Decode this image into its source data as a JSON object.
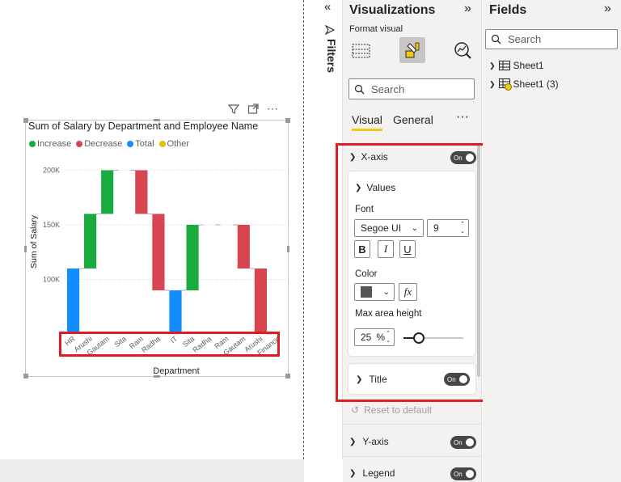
{
  "visual": {
    "title": "Sum of Salary by Department and Employee Name",
    "legend": [
      {
        "label": "Increase",
        "color": "#1aab40"
      },
      {
        "label": "Decrease",
        "color": "#d64550"
      },
      {
        "label": "Total",
        "color": "#118dff"
      },
      {
        "label": "Other",
        "color": "#e6c000"
      }
    ],
    "xlabel": "Department",
    "ylabel": "Sum of Salary",
    "header_icons": [
      "filter-icon",
      "focus-mode-icon",
      "more-options-icon"
    ]
  },
  "chart_data": {
    "type": "bar",
    "subtype": "waterfall",
    "title": "Sum of Salary by Department and Employee Name",
    "xlabel": "Department",
    "ylabel": "Sum of Salary",
    "ylim": [
      50000,
      210000
    ],
    "yticks": [
      "100K",
      "150K",
      "200K"
    ],
    "grid": true,
    "legend_position": "top-left",
    "categories": [
      "HR",
      "Arushi",
      "Gautam",
      "Sita",
      "Ram",
      "Radha",
      "IT",
      "Sita",
      "Radha",
      "Ram",
      "Gautam",
      "Arushi",
      "Finance"
    ],
    "bars": [
      {
        "label": "HR",
        "kind": "Total",
        "start": 50000,
        "end": 110000
      },
      {
        "label": "Arushi",
        "kind": "Increase",
        "start": 110000,
        "end": 160000
      },
      {
        "label": "Gautam",
        "kind": "Increase",
        "start": 160000,
        "end": 200000
      },
      {
        "label": "Sita",
        "kind": "Increase",
        "start": 200000,
        "end": 200000
      },
      {
        "label": "Ram",
        "kind": "Decrease",
        "start": 200000,
        "end": 160000
      },
      {
        "label": "Radha",
        "kind": "Decrease",
        "start": 160000,
        "end": 90000
      },
      {
        "label": "IT",
        "kind": "Total",
        "start": 50000,
        "end": 90000
      },
      {
        "label": "Sita",
        "kind": "Increase",
        "start": 90000,
        "end": 150000
      },
      {
        "label": "Radha",
        "kind": "Increase",
        "start": 150000,
        "end": 150000
      },
      {
        "label": "Ram",
        "kind": "Increase",
        "start": 150000,
        "end": 150000
      },
      {
        "label": "Gautam",
        "kind": "Decrease",
        "start": 150000,
        "end": 110000
      },
      {
        "label": "Arushi",
        "kind": "Decrease",
        "start": 110000,
        "end": 50000
      },
      {
        "label": "Finance",
        "kind": "Total",
        "start": 50000,
        "end": 50000
      }
    ]
  },
  "filters": {
    "label": "Filters"
  },
  "visualizations": {
    "title": "Visualizations",
    "subtitle": "Format visual",
    "search_placeholder": "Search",
    "tabs": [
      "Visual",
      "General"
    ],
    "more": "···",
    "xaxis": {
      "title": "X-axis",
      "toggle": "On",
      "values": {
        "title": "Values",
        "font_label": "Font",
        "font": "Segoe UI",
        "size": "9",
        "bold": "B",
        "italic": "I",
        "underline": "U",
        "color_label": "Color",
        "color": "#555555",
        "fx": "fx",
        "max_height_label": "Max area height",
        "max_height_value": "25",
        "max_height_unit": "%",
        "max_height_fraction": 0.25
      },
      "title_section": {
        "title": "Title",
        "toggle": "On"
      }
    },
    "reset": "Reset to default",
    "yaxis": {
      "title": "Y-axis",
      "toggle": "On"
    },
    "legend": {
      "title": "Legend",
      "toggle": "On"
    }
  },
  "fields": {
    "title": "Fields",
    "search_placeholder": "Search",
    "items": [
      "Sheet1",
      "Sheet1 (3)"
    ]
  }
}
